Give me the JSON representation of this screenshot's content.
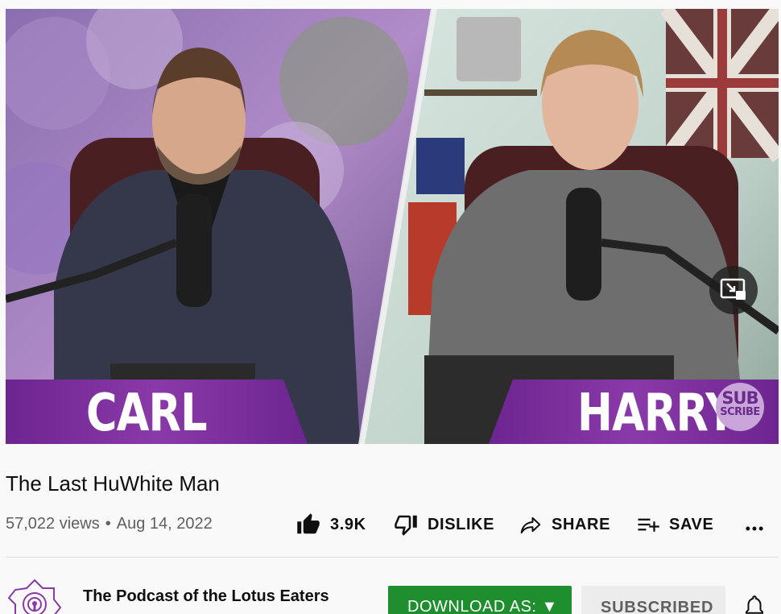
{
  "video": {
    "overlay_left": "CARL",
    "overlay_right": "HARRY",
    "subscribe_badge_line1": "SUB",
    "subscribe_badge_line2": "SCRIBE",
    "miniplayer_icon": "miniplayer-icon"
  },
  "title": "The Last HuWhite Man",
  "meta": {
    "views": "57,022 views",
    "separator": "•",
    "date": "Aug 14, 2022"
  },
  "actions": {
    "like_count": "3.9K",
    "dislike_label": "DISLIKE",
    "share_label": "SHARE",
    "save_label": "SAVE",
    "more_icon": "more-icon"
  },
  "channel": {
    "name": "The Podcast of the Lotus Eaters",
    "download_label": "DOWNLOAD AS: ▼",
    "subscribed_label": "SUBSCRIBED",
    "bell_icon": "bell-icon"
  },
  "colors": {
    "overlay_purple": "#7a2d9c",
    "download_green": "#1e8e2e",
    "subscribed_bg": "#ececec"
  }
}
